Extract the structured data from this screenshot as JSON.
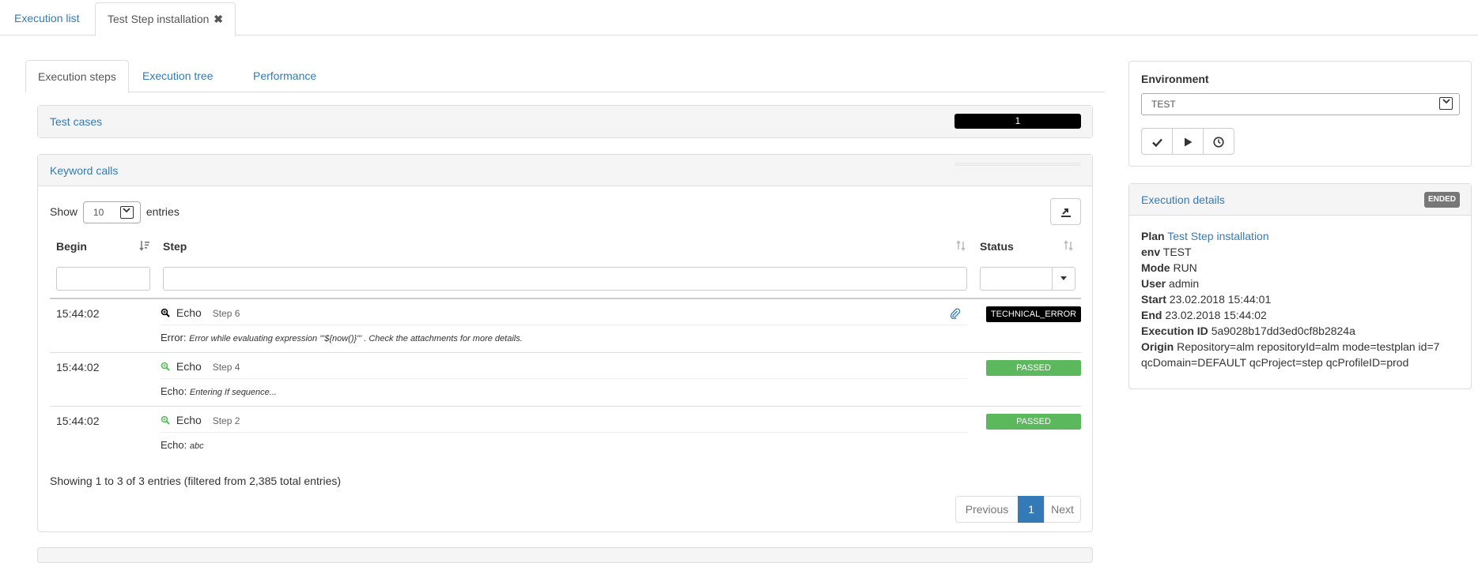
{
  "top_tabs": {
    "execution_list": "Execution list",
    "current": "Test Step installation",
    "close_glyph": "✖"
  },
  "inner_tabs": {
    "steps": "Execution steps",
    "tree": "Execution tree",
    "performance": "Performance"
  },
  "test_cases": {
    "title": "Test cases",
    "count": "1"
  },
  "keyword_calls": {
    "title": "Keyword calls",
    "show_label": "Show",
    "entries_label": "entries",
    "page_size": "10",
    "columns": {
      "begin": "Begin",
      "step": "Step",
      "status": "Status"
    },
    "rows": [
      {
        "time": "15:44:02",
        "keyword": "Echo",
        "step": "Step 6",
        "msg_prefix": "Error:",
        "msg": "Error while evaluating expression '\"${now()}\"' . Check the attachments for more details.",
        "status": "TECHNICAL_ERROR"
      },
      {
        "time": "15:44:02",
        "keyword": "Echo",
        "step": "Step 4",
        "msg_prefix": "Echo:",
        "msg": "Entering If sequence...",
        "status": "PASSED"
      },
      {
        "time": "15:44:02",
        "keyword": "Echo",
        "step": "Step 2",
        "msg_prefix": "Echo:",
        "msg": "abc",
        "status": "PASSED"
      }
    ],
    "info": "Showing 1 to 3 of 3 entries (filtered from 2,385 total entries)",
    "pagination": {
      "previous": "Previous",
      "current": "1",
      "next": "Next"
    }
  },
  "environment": {
    "title": "Environment",
    "value": "TEST"
  },
  "execution_details": {
    "title": "Execution details",
    "status_badge": "ENDED",
    "plan_label": "Plan",
    "plan_value": "Test Step installation",
    "env_label": "env",
    "env_value": "TEST",
    "mode_label": "Mode",
    "mode_value": "RUN",
    "user_label": "User",
    "user_value": "admin",
    "start_label": "Start",
    "start_value": "23.02.2018 15:44:01",
    "end_label": "End",
    "end_value": "23.02.2018 15:44:02",
    "id_label": "Execution ID",
    "id_value": "5a9028b17dd3ed0cf8b2824a",
    "origin_label": "Origin",
    "origin_value": "Repository=alm repositoryId=alm mode=testplan id=7 qcDomain=DEFAULT qcProject=step qcProfileID=prod"
  },
  "colors": {
    "link": "#337ab7",
    "passed": "#5cb85c",
    "technical_error": "#000000",
    "ended": "#777777"
  }
}
